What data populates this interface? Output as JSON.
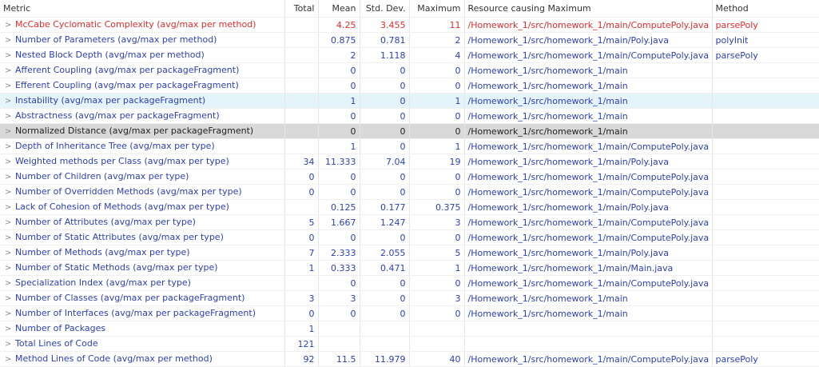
{
  "columns": {
    "metric": "Metric",
    "total": "Total",
    "mean": "Mean",
    "std": "Std. Dev.",
    "max": "Maximum",
    "resource": "Resource causing Maximum",
    "method": "Method"
  },
  "expand_glyph": ">",
  "colors": {
    "link_text": "#2b3fb8",
    "alert_text": "#e32b2b",
    "hover_row": "#e5f3fb",
    "selected_row": "#d9d9d9"
  },
  "rows": [
    {
      "metric": "McCabe Cyclomatic Complexity (avg/max per method)",
      "total": "",
      "mean": "4.25",
      "std": "3.455",
      "max": "11",
      "resource": "/Homework_1/src/homework_1/main/ComputePoly.java",
      "method": "parsePoly",
      "state": "alert"
    },
    {
      "metric": "Number of Parameters (avg/max per method)",
      "total": "",
      "mean": "0.875",
      "std": "0.781",
      "max": "2",
      "resource": "/Homework_1/src/homework_1/main/Poly.java",
      "method": "polyInit",
      "state": ""
    },
    {
      "metric": "Nested Block Depth (avg/max per method)",
      "total": "",
      "mean": "2",
      "std": "1.118",
      "max": "4",
      "resource": "/Homework_1/src/homework_1/main/ComputePoly.java",
      "method": "parsePoly",
      "state": ""
    },
    {
      "metric": "Afferent Coupling (avg/max per packageFragment)",
      "total": "",
      "mean": "0",
      "std": "0",
      "max": "0",
      "resource": "/Homework_1/src/homework_1/main",
      "method": "",
      "state": ""
    },
    {
      "metric": "Efferent Coupling (avg/max per packageFragment)",
      "total": "",
      "mean": "0",
      "std": "0",
      "max": "0",
      "resource": "/Homework_1/src/homework_1/main",
      "method": "",
      "state": ""
    },
    {
      "metric": "Instability (avg/max per packageFragment)",
      "total": "",
      "mean": "1",
      "std": "0",
      "max": "1",
      "resource": "/Homework_1/src/homework_1/main",
      "method": "",
      "state": "hover"
    },
    {
      "metric": "Abstractness (avg/max per packageFragment)",
      "total": "",
      "mean": "0",
      "std": "0",
      "max": "0",
      "resource": "/Homework_1/src/homework_1/main",
      "method": "",
      "state": ""
    },
    {
      "metric": "Normalized Distance (avg/max per packageFragment)",
      "total": "",
      "mean": "0",
      "std": "0",
      "max": "0",
      "resource": "/Homework_1/src/homework_1/main",
      "method": "",
      "state": "selected"
    },
    {
      "metric": "Depth of Inheritance Tree (avg/max per type)",
      "total": "",
      "mean": "1",
      "std": "0",
      "max": "1",
      "resource": "/Homework_1/src/homework_1/main/ComputePoly.java",
      "method": "",
      "state": ""
    },
    {
      "metric": "Weighted methods per Class (avg/max per type)",
      "total": "34",
      "mean": "11.333",
      "std": "7.04",
      "max": "19",
      "resource": "/Homework_1/src/homework_1/main/Poly.java",
      "method": "",
      "state": ""
    },
    {
      "metric": "Number of Children (avg/max per type)",
      "total": "0",
      "mean": "0",
      "std": "0",
      "max": "0",
      "resource": "/Homework_1/src/homework_1/main/ComputePoly.java",
      "method": "",
      "state": ""
    },
    {
      "metric": "Number of Overridden Methods (avg/max per type)",
      "total": "0",
      "mean": "0",
      "std": "0",
      "max": "0",
      "resource": "/Homework_1/src/homework_1/main/ComputePoly.java",
      "method": "",
      "state": ""
    },
    {
      "metric": "Lack of Cohesion of Methods (avg/max per type)",
      "total": "",
      "mean": "0.125",
      "std": "0.177",
      "max": "0.375",
      "resource": "/Homework_1/src/homework_1/main/Poly.java",
      "method": "",
      "state": ""
    },
    {
      "metric": "Number of Attributes (avg/max per type)",
      "total": "5",
      "mean": "1.667",
      "std": "1.247",
      "max": "3",
      "resource": "/Homework_1/src/homework_1/main/ComputePoly.java",
      "method": "",
      "state": ""
    },
    {
      "metric": "Number of Static Attributes (avg/max per type)",
      "total": "0",
      "mean": "0",
      "std": "0",
      "max": "0",
      "resource": "/Homework_1/src/homework_1/main/ComputePoly.java",
      "method": "",
      "state": ""
    },
    {
      "metric": "Number of Methods (avg/max per type)",
      "total": "7",
      "mean": "2.333",
      "std": "2.055",
      "max": "5",
      "resource": "/Homework_1/src/homework_1/main/Poly.java",
      "method": "",
      "state": ""
    },
    {
      "metric": "Number of Static Methods (avg/max per type)",
      "total": "1",
      "mean": "0.333",
      "std": "0.471",
      "max": "1",
      "resource": "/Homework_1/src/homework_1/main/Main.java",
      "method": "",
      "state": ""
    },
    {
      "metric": "Specialization Index (avg/max per type)",
      "total": "",
      "mean": "0",
      "std": "0",
      "max": "0",
      "resource": "/Homework_1/src/homework_1/main/ComputePoly.java",
      "method": "",
      "state": ""
    },
    {
      "metric": "Number of Classes (avg/max per packageFragment)",
      "total": "3",
      "mean": "3",
      "std": "0",
      "max": "3",
      "resource": "/Homework_1/src/homework_1/main",
      "method": "",
      "state": ""
    },
    {
      "metric": "Number of Interfaces (avg/max per packageFragment)",
      "total": "0",
      "mean": "0",
      "std": "0",
      "max": "0",
      "resource": "/Homework_1/src/homework_1/main",
      "method": "",
      "state": ""
    },
    {
      "metric": "Number of Packages",
      "total": "1",
      "mean": "",
      "std": "",
      "max": "",
      "resource": "",
      "method": "",
      "state": ""
    },
    {
      "metric": "Total Lines of Code",
      "total": "121",
      "mean": "",
      "std": "",
      "max": "",
      "resource": "",
      "method": "",
      "state": ""
    },
    {
      "metric": "Method Lines of Code (avg/max per method)",
      "total": "92",
      "mean": "11.5",
      "std": "11.979",
      "max": "40",
      "resource": "/Homework_1/src/homework_1/main/ComputePoly.java",
      "method": "parsePoly",
      "state": ""
    }
  ]
}
